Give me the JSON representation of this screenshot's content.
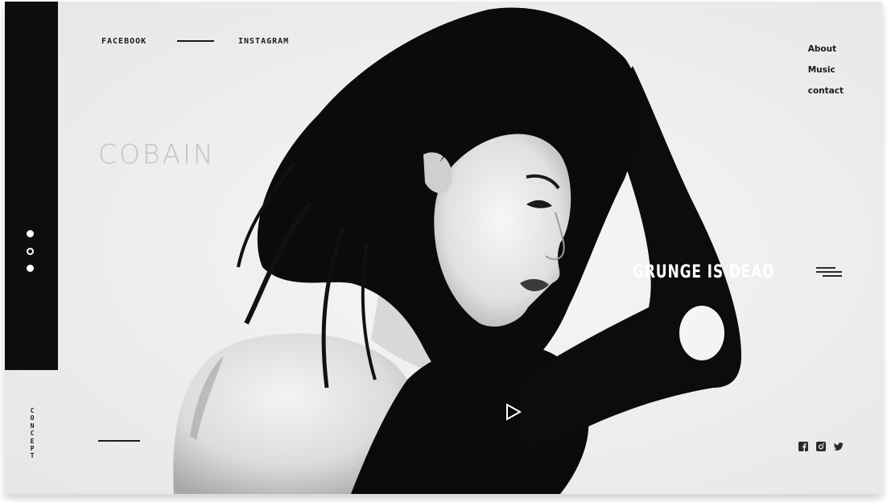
{
  "social_top": {
    "facebook_label": "FACEBOOK",
    "instagram_label": "INSTAGRAM"
  },
  "brand": {
    "name": "COBAIN"
  },
  "nav": {
    "items": [
      {
        "label": "About"
      },
      {
        "label": "Music"
      },
      {
        "label": "contact"
      }
    ]
  },
  "hero": {
    "tagline": "GRUNGE IS DEAD",
    "photo_subject": "black-and-white portrait of a woman with dark hair"
  },
  "side": {
    "label": "CONCEPT",
    "slides": [
      {
        "state": "filled"
      },
      {
        "state": "hollow"
      },
      {
        "state": "filled"
      }
    ]
  },
  "icons": {
    "menu": "hamburger-menu-icon",
    "play": "play-icon",
    "facebook": "facebook-icon",
    "instagram": "instagram-icon",
    "twitter": "twitter-icon"
  },
  "colors": {
    "background": "#ececec",
    "bar": "#0d0d0d",
    "text": "#1a1a1a",
    "brand_text": "#c2c2c2",
    "accent_white": "#ffffff"
  }
}
